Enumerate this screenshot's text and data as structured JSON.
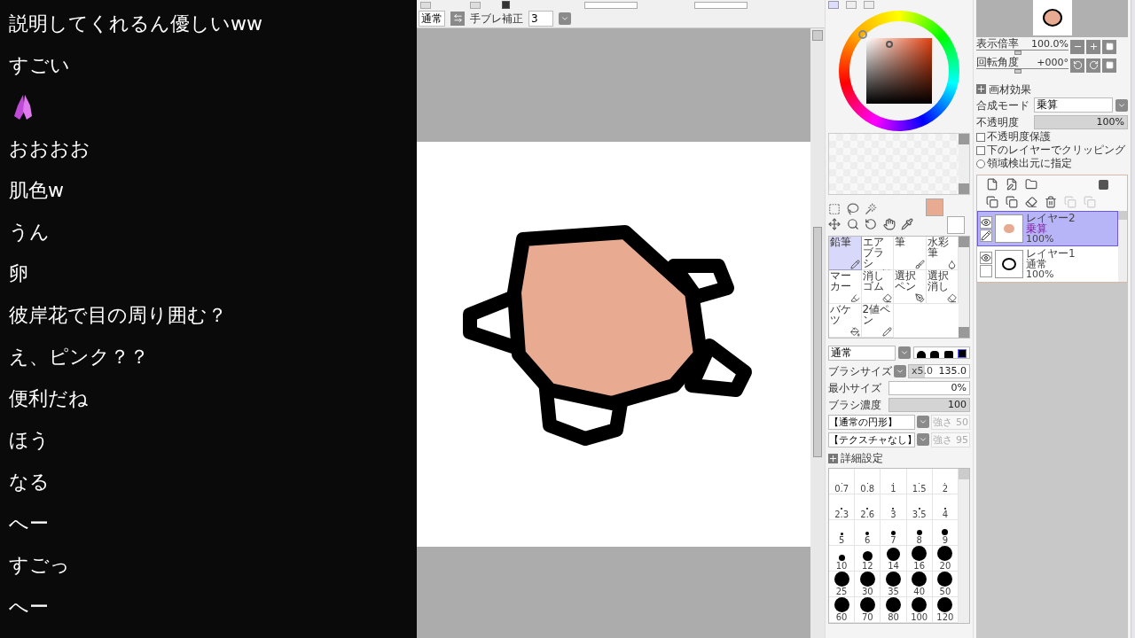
{
  "chat": {
    "messages": [
      {
        "kind": "text",
        "text": "説明してくれるん優しいww"
      },
      {
        "kind": "text",
        "text": "すごい"
      },
      {
        "kind": "emoji"
      },
      {
        "kind": "text",
        "text": "おおおお"
      },
      {
        "kind": "text",
        "text": "肌色w"
      },
      {
        "kind": "text",
        "text": "うん"
      },
      {
        "kind": "text",
        "text": "卵"
      },
      {
        "kind": "text",
        "text": "彼岸花で目の周り囲む？"
      },
      {
        "kind": "text",
        "text": "え、ピンク？？"
      },
      {
        "kind": "text",
        "text": "便利だね"
      },
      {
        "kind": "text",
        "text": "ほう"
      },
      {
        "kind": "text",
        "text": "なる"
      },
      {
        "kind": "text",
        "text": "へー"
      },
      {
        "kind": "text",
        "text": "すごっ"
      },
      {
        "kind": "text",
        "text": "へー"
      }
    ]
  },
  "toolbar": {
    "selection_checkbox": {
      "checked": true
    },
    "blend_mode": "通常",
    "stabilizer_label": "手ブレ補正",
    "stabilizer_value": "3"
  },
  "tools": [
    {
      "label": "鉛筆",
      "kind": "pencil",
      "selected": true
    },
    {
      "label": "エアブラシ",
      "kind": "airbrush",
      "selected": false
    },
    {
      "label": "筆",
      "kind": "brush",
      "selected": false
    },
    {
      "label": "水彩筆",
      "kind": "watercolor",
      "selected": false
    },
    {
      "label": "マーカー",
      "kind": "marker",
      "selected": false
    },
    {
      "label": "消しゴム",
      "kind": "eraser",
      "selected": false
    },
    {
      "label": "選択ペン",
      "kind": "selpen",
      "selected": false
    },
    {
      "label": "選択消し",
      "kind": "selerase",
      "selected": false
    },
    {
      "label": "バケツ",
      "kind": "bucket",
      "selected": false
    },
    {
      "label": "2値ペン",
      "kind": "binary",
      "selected": false
    }
  ],
  "brush": {
    "blend": "通常",
    "size_label": "ブラシサイズ",
    "size_multiplier": "x5.0",
    "size_value": "135.0",
    "size_slider": {
      "level": 0.27
    },
    "min_size_label": "最小サイズ",
    "min_size_value": "0%",
    "min_size_slider": {
      "level": 0
    },
    "density_label": "ブラシ濃度",
    "density_value": "100",
    "density_slider": {
      "level": 1
    },
    "shape": "【通常の円形】",
    "shape_strength_label": "強さ",
    "shape_strength": "50",
    "shape_disabled": true,
    "texture": "【テクスチャなし】",
    "texture_strength_label": "強さ",
    "texture_strength": "95",
    "texture_disabled": true,
    "advanced_label": "詳細設定"
  },
  "brush_sizes": [
    "0.7",
    "0.8",
    "1",
    "1.5",
    "2",
    "2.3",
    "2.6",
    "3",
    "3.5",
    "4",
    "5",
    "6",
    "7",
    "8",
    "9",
    "10",
    "12",
    "14",
    "16",
    "20",
    "25",
    "30",
    "35",
    "40",
    "50",
    "60",
    "70",
    "80",
    "100",
    "120"
  ],
  "navigator": {
    "zoom_label": "表示倍率",
    "zoom_value": "100.0%",
    "zoom_slider": {
      "level": 0.45
    },
    "angle_label": "回転角度",
    "angle_value": "+000°",
    "angle_slider": {
      "level": 0.45
    }
  },
  "layer_props": {
    "effects_label": "画材効果",
    "blend_label": "合成モード",
    "blend_value": "乗算",
    "opacity_label": "不透明度",
    "opacity_value": "100%",
    "opacity_slider": {
      "level": 1
    },
    "options": [
      {
        "label": "不透明度保護",
        "kind": "checkbox",
        "checked": false
      },
      {
        "label": "下のレイヤーでクリッピング",
        "kind": "checkbox",
        "checked": false
      },
      {
        "label": "領域検出元に指定",
        "kind": "radio",
        "checked": false
      }
    ]
  },
  "layers": [
    {
      "name": "レイヤー2",
      "mode": "乗算",
      "opacity": "100%",
      "selected": true,
      "kind": "blob"
    },
    {
      "name": "レイヤー1",
      "mode": "通常",
      "opacity": "100%",
      "selected": false,
      "kind": "outline"
    }
  ]
}
